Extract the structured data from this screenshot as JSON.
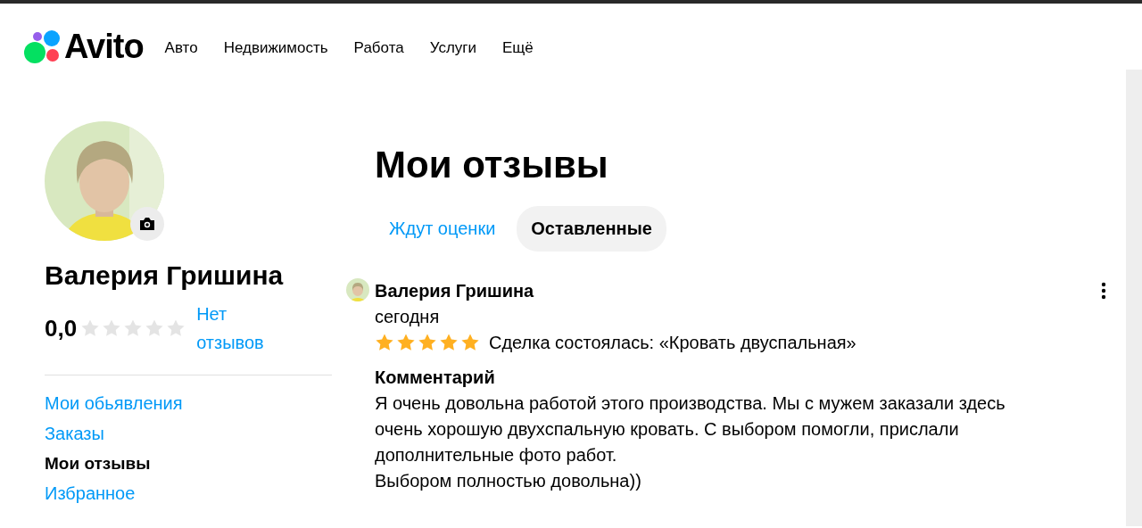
{
  "header": {
    "logo": "Avito",
    "nav": [
      {
        "label": "Авто"
      },
      {
        "label": "Недвижимость"
      },
      {
        "label": "Работа"
      },
      {
        "label": "Услуги"
      },
      {
        "label": "Ещё"
      }
    ]
  },
  "profile": {
    "name": "Валерия Гришина",
    "rating": "0,0",
    "stars": 0,
    "reviews_link": "Нет отзывов"
  },
  "sidebar": {
    "items": [
      {
        "label": "Мои обьявления",
        "selected": false
      },
      {
        "label": "Заказы",
        "selected": false
      },
      {
        "label": "Мои отзывы",
        "selected": true
      },
      {
        "label": "Избранное",
        "selected": false
      }
    ]
  },
  "page_title": "Мои отзывы",
  "tabs": [
    {
      "label": "Ждут оценки",
      "selected": false
    },
    {
      "label": "Оставленные",
      "selected": true
    }
  ],
  "review": {
    "author": "Валерия Гришина",
    "date": "сегодня",
    "stars": 5,
    "deal": "Сделка состоялась: «Кровать двуспальная»",
    "comment_heading": "Комментарий",
    "comment": [
      "Я очень довольна работой этого производства. Мы с мужем заказали здесь",
      "очень хорошую двухспальную кровать. С выбором помогли, прислали",
      "дополнительные фото работ.",
      "Выбором полностью довольна))"
    ]
  }
}
